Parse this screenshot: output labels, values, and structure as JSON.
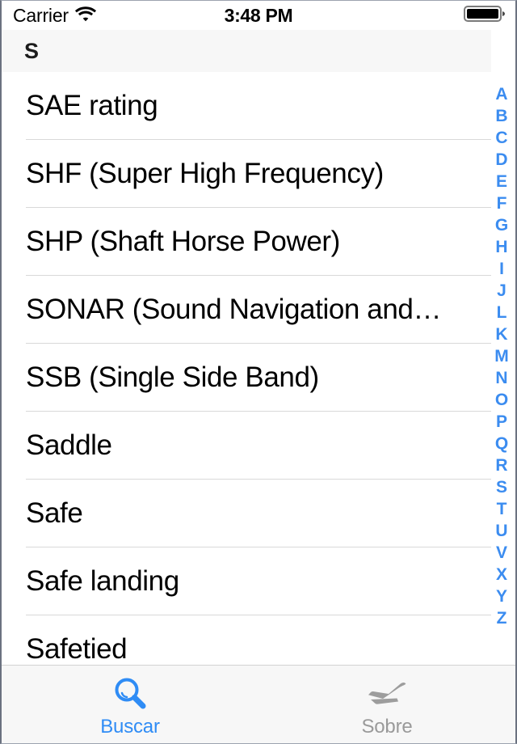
{
  "status_bar": {
    "carrier": "Carrier",
    "wifi_icon": "wifi-icon",
    "time": "3:48 PM",
    "battery_icon": "battery-full-icon"
  },
  "section": {
    "header_letter": "S"
  },
  "list": {
    "rows": [
      {
        "label": "SAE rating"
      },
      {
        "label": "SHF (Super High Frequency)"
      },
      {
        "label": "SHP (Shaft Horse Power)"
      },
      {
        "label": "SONAR (Sound Navigation and…"
      },
      {
        "label": "SSB (Single Side Band)"
      },
      {
        "label": "Saddle"
      },
      {
        "label": "Safe"
      },
      {
        "label": "Safe landing"
      },
      {
        "label": "Safetied"
      }
    ]
  },
  "index_bar": {
    "letters": [
      "A",
      "B",
      "C",
      "D",
      "E",
      "F",
      "G",
      "H",
      "I",
      "J",
      "L",
      "K",
      "M",
      "N",
      "O",
      "P",
      "Q",
      "R",
      "S",
      "T",
      "U",
      "V",
      "X",
      "Y",
      "Z"
    ],
    "color": "#3b8cf0"
  },
  "tab_bar": {
    "tabs": [
      {
        "label": "Buscar",
        "icon": "magnifying-glass-icon",
        "active": true,
        "color": "#2f8cf5"
      },
      {
        "label": "Sobre",
        "icon": "airplane-icon",
        "active": false,
        "color": "#9a9a9a"
      }
    ]
  }
}
